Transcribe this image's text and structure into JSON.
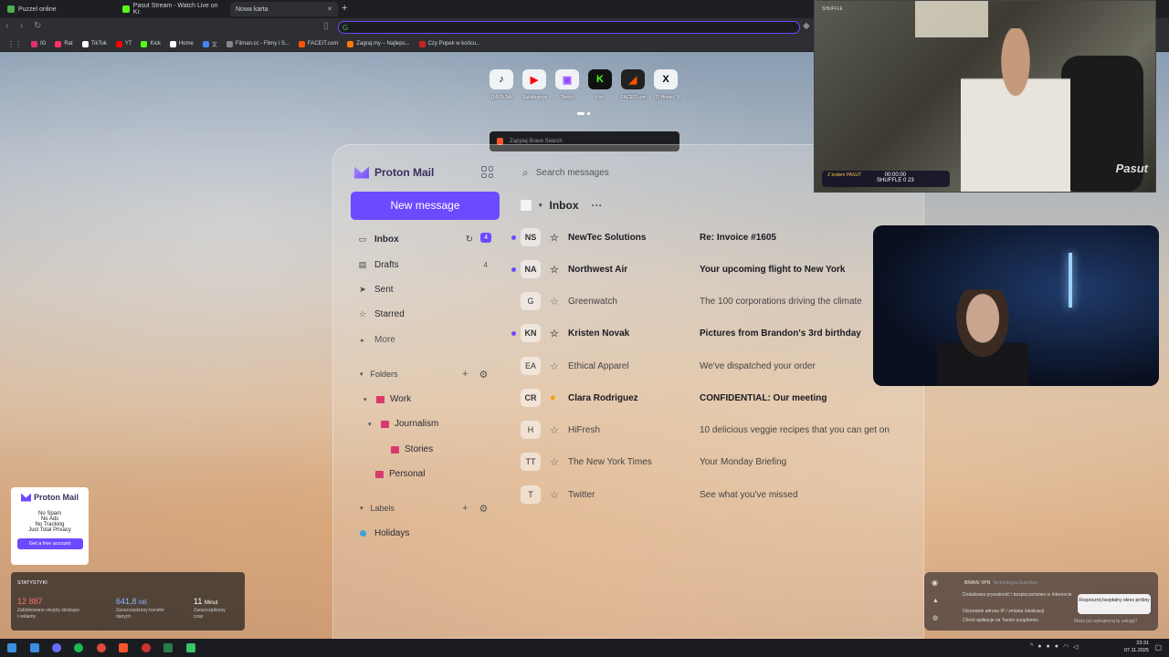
{
  "browser": {
    "tabs": [
      {
        "label": "Puzzel online",
        "color": "#4caf50"
      },
      {
        "label": "Pasut Stream - Watch Live on Ki:",
        "color": "#53fc18"
      },
      {
        "label": "Nowa karta",
        "color": "#ffffff"
      }
    ],
    "new_tab": "+",
    "bookmarks": [
      {
        "label": "IG",
        "color": "#e1306c"
      },
      {
        "label": "Rat",
        "color": "#ff3366"
      },
      {
        "label": "TikTok",
        "color": "#ffffff"
      },
      {
        "label": "YT",
        "color": "#ff0000"
      },
      {
        "label": "Kick",
        "color": "#53fc18"
      },
      {
        "label": "Home",
        "color": "#ffffff"
      },
      {
        "label": "文",
        "color": "#4285f4"
      },
      {
        "label": "Filman.cc - Filmy i S...",
        "color": "#888888"
      },
      {
        "label": "FACEIT.com",
        "color": "#ff5500"
      },
      {
        "label": "Zagraj.my – Najleps...",
        "color": "#ff7a00"
      },
      {
        "label": "Czy Popek w końcu...",
        "color": "#cc2222"
      }
    ]
  },
  "shortcuts": [
    {
      "label": "(14)TikTok",
      "icon": "tiktok-icon",
      "glyph": "♪",
      "color": "#000000"
    },
    {
      "label": "Subskrypcje",
      "icon": "youtube-icon",
      "glyph": "▶",
      "color": "#ff0000"
    },
    {
      "label": "Twitch",
      "icon": "twitch-icon",
      "glyph": "▣",
      "color": "#9146ff"
    },
    {
      "label": "Kick",
      "icon": "kick-icon",
      "glyph": "K",
      "color": "#53fc18"
    },
    {
      "label": "FACEIT.com",
      "icon": "faceit-icon",
      "glyph": "◢",
      "color": "#ff5500"
    },
    {
      "label": "(3) Home / X",
      "icon": "x-icon",
      "glyph": "X",
      "color": "#000000"
    }
  ],
  "brave_search": {
    "placeholder": "Zapytaj Brave Search"
  },
  "proton": {
    "logo": "Proton Mail",
    "search_placeholder": "Search messages",
    "new_message": "New message",
    "nav": [
      {
        "label": "Inbox",
        "icon": "inbox-icon",
        "count": "4"
      },
      {
        "label": "Drafts",
        "icon": "drafts-icon",
        "count": "4"
      },
      {
        "label": "Sent",
        "icon": "sent-icon",
        "count": ""
      },
      {
        "label": "Starred",
        "icon": "star-icon",
        "count": ""
      },
      {
        "label": "More",
        "icon": "chevron-right-icon",
        "count": ""
      }
    ],
    "folders_title": "Folders",
    "folders": [
      {
        "label": "Work"
      },
      {
        "label": "Journalism"
      },
      {
        "label": "Stories"
      },
      {
        "label": "Personal"
      }
    ],
    "labels_title": "Labels",
    "labels": [
      {
        "label": "Holidays",
        "color": "#3aa1e0"
      }
    ],
    "inbox_title": "Inbox",
    "messages": [
      {
        "initials": "NS",
        "sender": "NewTec Solutions",
        "subject": "Re: Invoice #1605",
        "unread": true,
        "starred": false
      },
      {
        "initials": "NA",
        "sender": "Northwest Air",
        "subject": "Your upcoming flight to New York",
        "unread": true,
        "starred": false
      },
      {
        "initials": "G",
        "sender": "Greenwatch",
        "subject": "The 100 corporations driving the climate",
        "unread": false,
        "starred": false
      },
      {
        "initials": "KN",
        "sender": "Kristen Novak",
        "subject": "Pictures from Brandon's 3rd birthday",
        "unread": true,
        "starred": false
      },
      {
        "initials": "EA",
        "sender": "Ethical Apparel",
        "subject": "We've dispatched your order",
        "unread": false,
        "starred": false
      },
      {
        "initials": "CR",
        "sender": "Clara Rodriguez",
        "subject": "CONFIDENTIAL: Our meeting",
        "unread": false,
        "starred": true
      },
      {
        "initials": "H",
        "sender": "HiFresh",
        "subject": "10 delicious veggie recipes that you can get on",
        "unread": false,
        "starred": false
      },
      {
        "initials": "TT",
        "sender": "The New York Times",
        "subject": "Your Monday Briefing",
        "unread": false,
        "starred": false
      },
      {
        "initials": "T",
        "sender": "Twitter",
        "subject": "See what you've missed",
        "unread": false,
        "starred": false
      }
    ]
  },
  "stream": {
    "tag": "SHUFFLE",
    "timer_line1": "00:00:00",
    "timer_line2": "SHUFFLE 0 23",
    "code_line": "Z kodem PASUT",
    "brand": "Pasut"
  },
  "promo": {
    "logo": "Proton Mail",
    "lines": [
      "No Spam",
      "No Ads",
      "No Tracking",
      "Just Total Privacy"
    ],
    "button": "Get a free account"
  },
  "stats": {
    "title": "STATYSTYKI",
    "items": [
      {
        "value": "12 887",
        "unit": "",
        "desc": "Zablokowane skrypty śledzące i reklamy",
        "color": "#ff6b6b"
      },
      {
        "value": "641,8",
        "unit": "MB",
        "desc": "Zaoszczędzony transfer danych",
        "color": "#8ab4ff"
      },
      {
        "value": "11",
        "unit": "Minut",
        "desc": "Zaoszczędzony czas",
        "color": "#ffffff"
      }
    ]
  },
  "vpn": {
    "title": "BRAVE VPN",
    "subtitle": "Technologia  Guardian",
    "features": [
      "Dodatkowa prywatność i bezpieczeństwo w Internecie",
      "Ukrywanie adresu IP / zmiana lokalizacji",
      "Chroń aplikacje na Twoim urządzeniu"
    ],
    "cta": "Rozpocznij bezpłatny okres próbny",
    "later": "Masz już wykupioną tę usługę?"
  },
  "taskbar": {
    "time": "23:31",
    "date": "07.11.2025"
  }
}
